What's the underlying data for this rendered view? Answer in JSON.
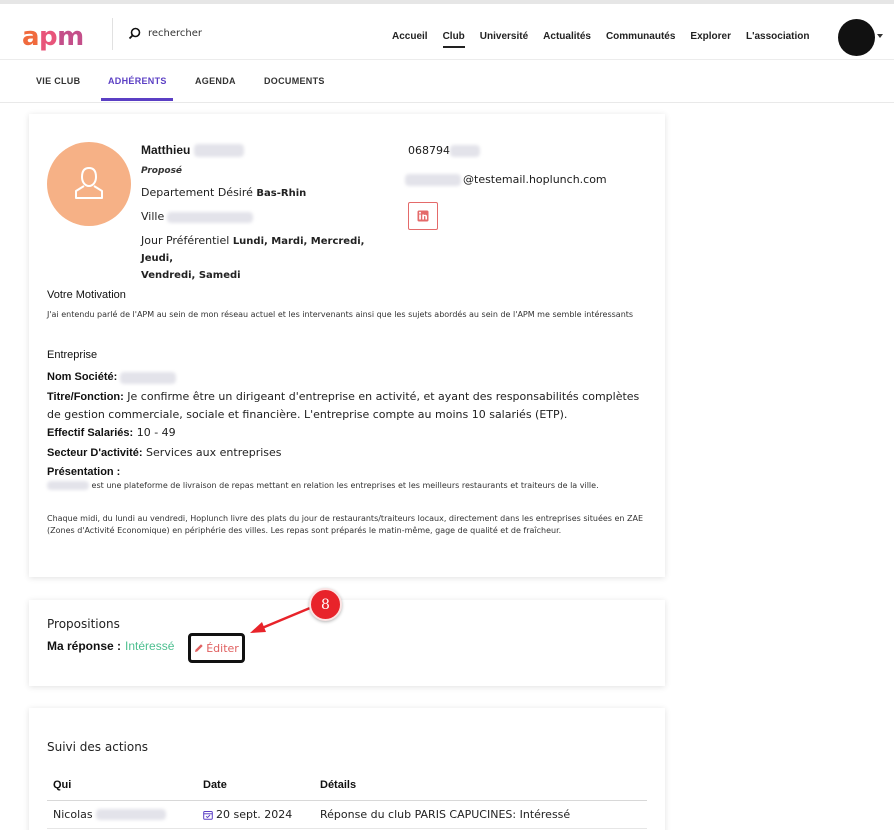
{
  "logo": {
    "text_a": "a",
    "text_p": "p",
    "text_m": "m"
  },
  "search": {
    "label": "rechercher",
    "icon": "search-icon"
  },
  "nav": [
    "Accueil",
    "Club",
    "Université",
    "Actualités",
    "Communautés",
    "Explorer",
    "L'association"
  ],
  "nav_active": "Club",
  "subtabs": [
    "VIE CLUB",
    "ADHÉRENTS",
    "AGENDA",
    "DOCUMENTS"
  ],
  "subtabs_active": "ADHÉRENTS",
  "profile": {
    "first_name": "Matthieu",
    "status": "Proposé",
    "dept_label": "Departement Désiré",
    "dept_value": "Bas-Rhin",
    "ville_label": "Ville",
    "jour_label": "Jour Préférentiel",
    "jour_value_1": "Lundi, Mardi, Mercredi, Jeudi,",
    "jour_value_2": "Vendredi, Samedi",
    "phone_prefix": "068794",
    "email_suffix": "@testemail.hoplunch.com",
    "linkedin_icon": "in"
  },
  "motivation": {
    "title": "Votre Motivation",
    "text": "J'ai entendu parlé de l'APM au sein de mon réseau actuel et les intervenants ainsi que les sujets abordés au sein de l'APM me semble intéressants"
  },
  "entreprise": {
    "title": "Entreprise",
    "nom_label": "Nom Société:",
    "titre_label": "Titre/Fonction:",
    "titre_value": " Je confirme être un dirigeant d'entreprise en activité, et ayant des responsabilités complètes de gestion commerciale, sociale et financière. L'entreprise compte au moins 10 salariés (ETP).",
    "effectif_label": "Effectif Salariés:",
    "effectif_value": " 10 - 49",
    "secteur_label": "Secteur D'activité:",
    "secteur_value": " Services aux entreprises",
    "presentation_label": "Présentation :",
    "presentation_1": "est une plateforme de livraison de repas mettant en relation les entreprises et les meilleurs restaurants et traiteurs de la ville.",
    "presentation_2": "Chaque midi, du lundi au vendredi, Hoplunch livre des plats du jour de restaurants/traiteurs locaux, directement dans les entreprises situées en ZAE (Zones d'Activité Economique) en périphérie des villes. Les repas sont préparés le matin-même, gage de qualité et de fraîcheur."
  },
  "propositions": {
    "title": "Propositions",
    "answer_label": "Ma réponse :",
    "answer_value": "Intéressé",
    "edit_label": "Éditer",
    "step_badge": "8"
  },
  "suivi": {
    "title": "Suivi des actions",
    "columns": [
      "Qui",
      "Date",
      "Détails"
    ],
    "rows": [
      {
        "qui": "Nicolas",
        "date": "20 sept. 2024",
        "details": "Réponse du club PARIS CAPUCINES: Intéressé"
      }
    ]
  },
  "colors": {
    "accent": "#5b3fc4",
    "avatar": "#f6b186",
    "interesse": "#4cbf8f",
    "edit": "#e06060",
    "badge": "#e8232a"
  }
}
